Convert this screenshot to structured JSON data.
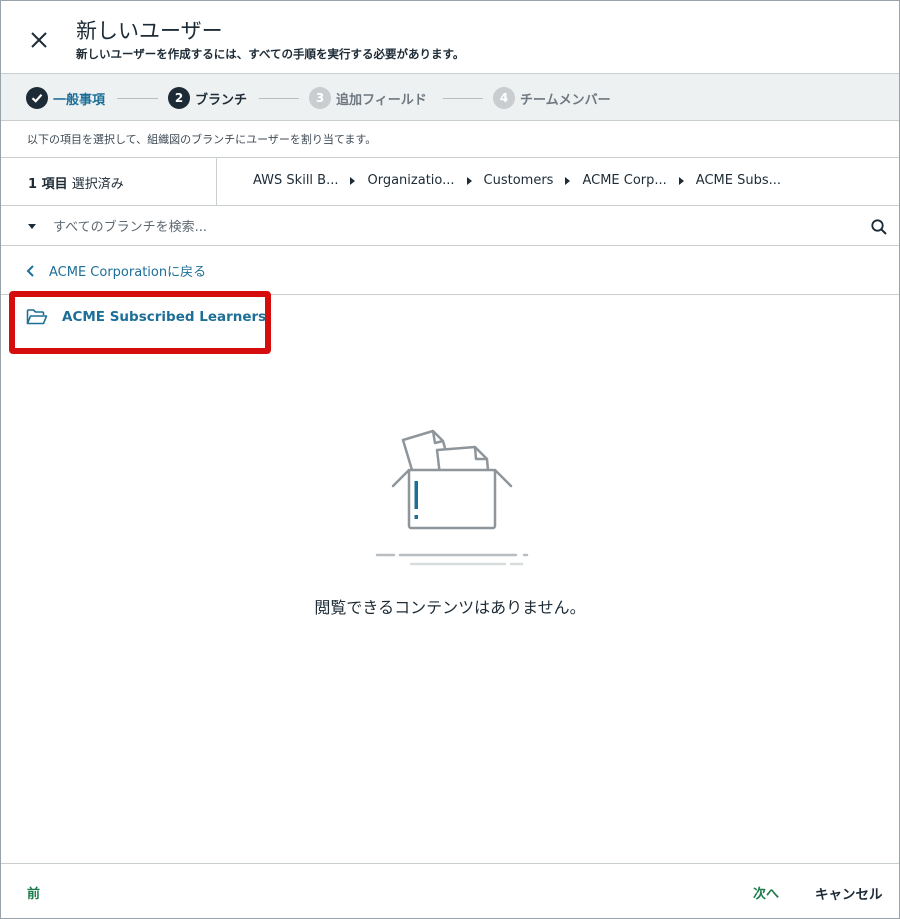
{
  "header": {
    "title": "新しいユーザー",
    "subtitle": "新しいユーザーを作成するには、すべての手順を実行する必要があります。"
  },
  "stepper": {
    "steps": [
      {
        "number": "",
        "label": "一般事項",
        "state": "completed"
      },
      {
        "number": "2",
        "label": "ブランチ",
        "state": "current"
      },
      {
        "number": "3",
        "label": "追加フィールド",
        "state": "upcoming"
      },
      {
        "number": "4",
        "label": "チームメンバー",
        "state": "upcoming"
      }
    ]
  },
  "instruction": "以下の項目を選択して、組織図のブランチにユーザーを割り当てます。",
  "selection": {
    "count_bold": "1 項目",
    "count_suffix": " 選択済み"
  },
  "breadcrumb": [
    "AWS Skill B...",
    "Organizatio...",
    "Customers",
    "ACME Corp...",
    "ACME Subs..."
  ],
  "search": {
    "placeholder": "すべてのブランチを検索..."
  },
  "back_link": "ACME Corporationに戻る",
  "branch_item": "ACME Subscribed Learners",
  "empty_state": "閲覧できるコンテンツはありません。",
  "footer": {
    "prev": "前",
    "next": "次へ",
    "cancel": "キャンセル"
  },
  "colors": {
    "link_blue": "#1d6f98",
    "highlight_red": "#d60d0d",
    "footer_green": "#1c7c4c",
    "stepper_bg": "#eef1f1"
  }
}
